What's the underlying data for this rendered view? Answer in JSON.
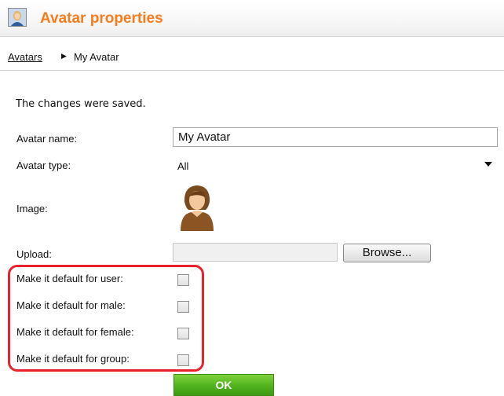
{
  "header": {
    "title": "Avatar properties",
    "icon": "avatar-properties-icon"
  },
  "breadcrumb": {
    "link_label": "Avatars",
    "separator": "▶",
    "current": "My Avatar"
  },
  "message": "The changes were saved.",
  "form": {
    "avatar_name_label": "Avatar name:",
    "avatar_name_value": "My Avatar",
    "avatar_type_label": "Avatar type:",
    "avatar_type_value": "All",
    "image_label": "Image:",
    "upload_label": "Upload:",
    "browse_label": "Browse...",
    "defaults": [
      {
        "label": "Make it default for user:",
        "checked": false
      },
      {
        "label": "Make it default for male:",
        "checked": false
      },
      {
        "label": "Make it default for female:",
        "checked": false
      },
      {
        "label": "Make it default for group:",
        "checked": false
      }
    ],
    "ok_label": "OK"
  },
  "colors": {
    "title": "#f57d1f",
    "highlight": "#e8212b",
    "ok_button": "#4fb21d"
  }
}
